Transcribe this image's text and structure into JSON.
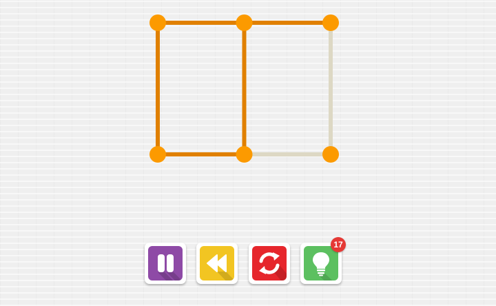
{
  "puzzle": {
    "colors": {
      "drawn": "#e08000",
      "undrawn": "#ddd8c4",
      "dot": "#fc9a00"
    },
    "dots": [
      {
        "id": "a",
        "col": 0,
        "row": 0
      },
      {
        "id": "b",
        "col": 1,
        "row": 0
      },
      {
        "id": "c",
        "col": 2,
        "row": 0
      },
      {
        "id": "d",
        "col": 0,
        "row": 1
      },
      {
        "id": "e",
        "col": 1,
        "row": 1
      },
      {
        "id": "f",
        "col": 2,
        "row": 1
      }
    ],
    "edges": [
      {
        "from": "c",
        "to": "f",
        "drawn": false
      },
      {
        "from": "e",
        "to": "f",
        "drawn": false
      },
      {
        "from": "a",
        "to": "b",
        "drawn": true
      },
      {
        "from": "b",
        "to": "c",
        "drawn": true
      },
      {
        "from": "a",
        "to": "d",
        "drawn": true
      },
      {
        "from": "b",
        "to": "e",
        "drawn": true
      },
      {
        "from": "d",
        "to": "e",
        "drawn": true
      }
    ]
  },
  "toolbar": {
    "buttons": [
      {
        "name": "pause-button",
        "icon": "pause-icon",
        "color": "#8e4aa6"
      },
      {
        "name": "undo-button",
        "icon": "rewind-icon",
        "color": "#f2c522"
      },
      {
        "name": "restart-button",
        "icon": "refresh-icon",
        "color": "#e6262c"
      },
      {
        "name": "hint-button",
        "icon": "lightbulb-icon",
        "color": "#5cc060"
      }
    ],
    "hint_count": "17"
  }
}
